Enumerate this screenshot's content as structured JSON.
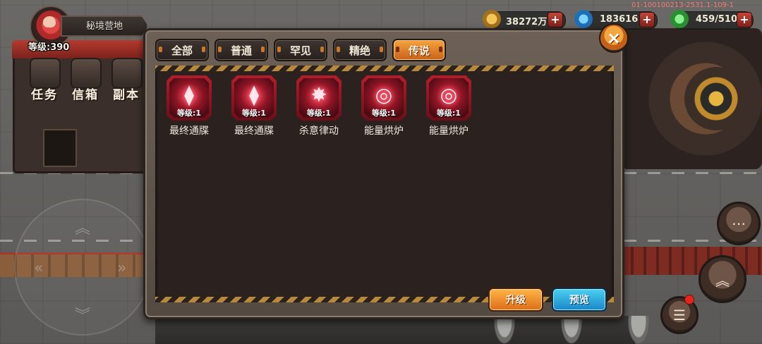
{
  "hud": {
    "location": "秘境营地",
    "level": "等级:390",
    "menu": [
      "任务",
      "信箱",
      "副本"
    ],
    "build_id": "01-100100213-2531.1-109-1"
  },
  "currency": [
    {
      "icon": "gold-coin-icon",
      "value": "38272万",
      "color": "#d8a43a"
    },
    {
      "icon": "blue-gem-icon",
      "value": "183616",
      "color": "#3a9be0"
    },
    {
      "icon": "green-energy-icon",
      "value": "459/510",
      "color": "#3fbf4a"
    }
  ],
  "tabs": [
    {
      "label": "全部",
      "active": false
    },
    {
      "label": "普通",
      "active": false
    },
    {
      "label": "罕见",
      "active": false
    },
    {
      "label": "精绝",
      "active": false
    },
    {
      "label": "传说",
      "active": true
    }
  ],
  "items": [
    {
      "icon": "kite-shard-icon",
      "level": "等级:1",
      "name": "最终通牒"
    },
    {
      "icon": "kite-shard-icon",
      "level": "等级:1",
      "name": "最终通牒"
    },
    {
      "icon": "burst-wings-icon",
      "level": "等级:1",
      "name": "杀意律动"
    },
    {
      "icon": "core-orbit-icon",
      "level": "等级:1",
      "name": "能量烘炉"
    },
    {
      "icon": "core-orbit-icon",
      "level": "等级:1",
      "name": "能量烘炉"
    }
  ],
  "buttons": {
    "upgrade": "升级",
    "preview": "预览",
    "close": "×"
  }
}
